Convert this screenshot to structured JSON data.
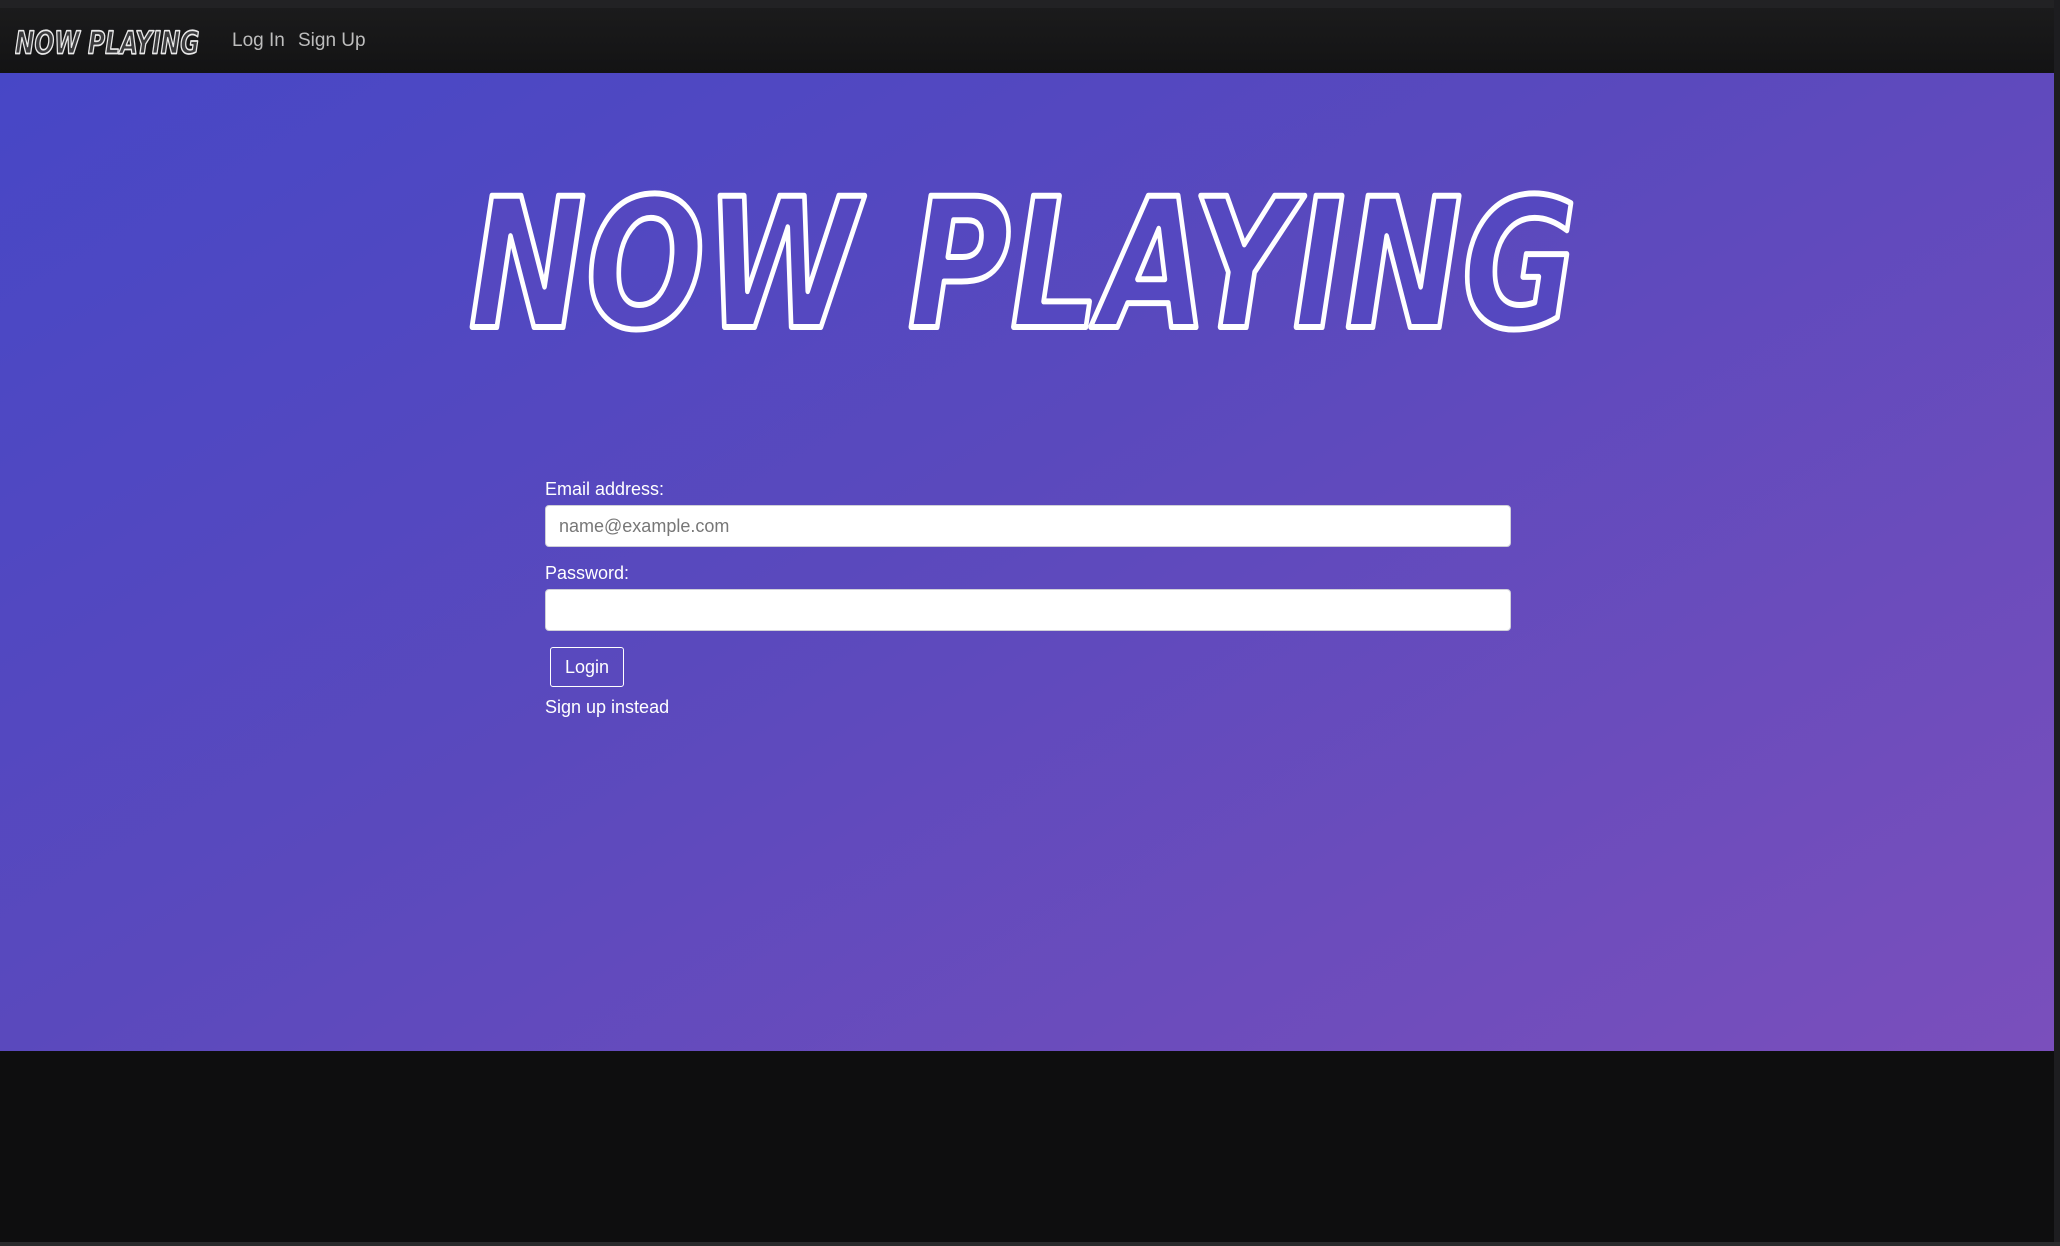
{
  "navbar": {
    "brand": "NOW PLAYING",
    "links": [
      {
        "label": "Log In"
      },
      {
        "label": "Sign Up"
      }
    ]
  },
  "hero": {
    "logo_text": "NOW PLAYING"
  },
  "form": {
    "email_label": "Email address:",
    "email_placeholder": "name@example.com",
    "email_value": "",
    "password_label": "Password:",
    "password_value": "",
    "submit_label": "Login",
    "alt_link": "Sign up instead"
  },
  "colors": {
    "gradient_start": "#4747c6",
    "gradient_end": "#7a4fbc",
    "navbar": "#161617",
    "background": "#0e0e0f"
  }
}
